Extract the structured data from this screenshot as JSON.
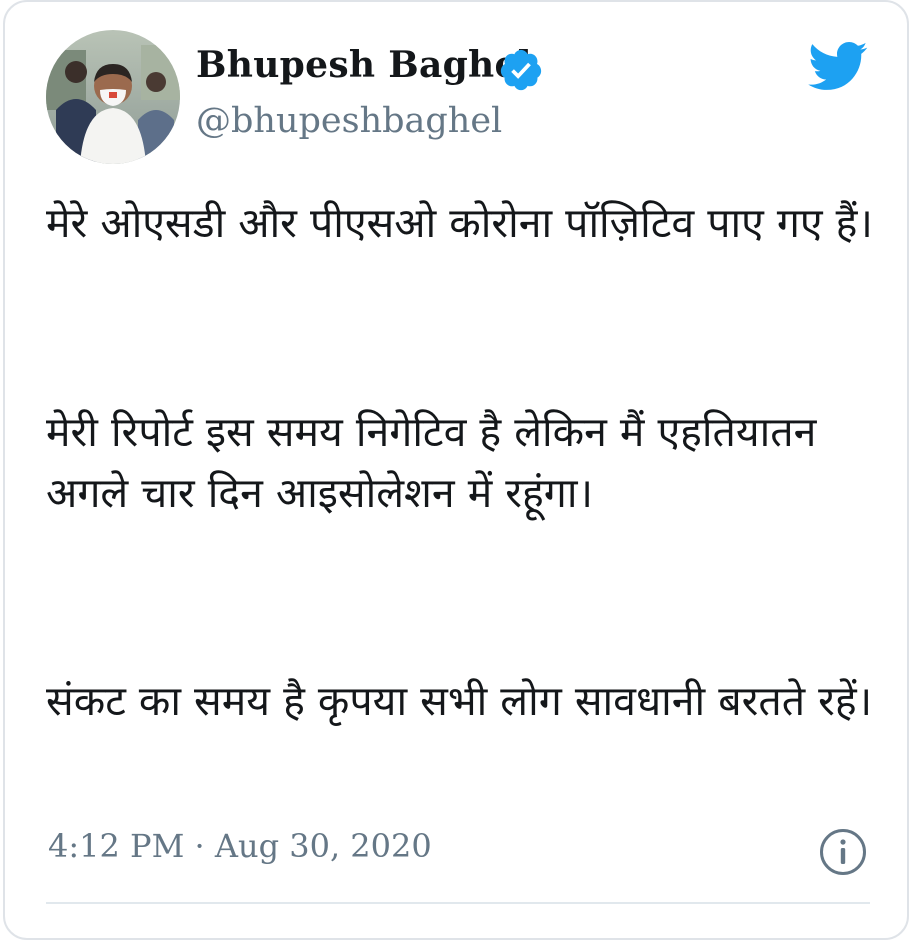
{
  "author": {
    "name": "Bhupesh Baghel",
    "handle": "@bhupeshbaghel"
  },
  "tweet": {
    "paragraphs": [
      "मेरे ओएसडी और पीएसओ कोरोना पॉज़िटिव पाए गए हैं।",
      "मेरी रिपोर्ट इस समय निगेटिव है लेकिन मैं एहतियातन अगले चार दिन आइसोलेशन में रहूंगा।",
      "संकट का समय है कृपया सभी लोग सावधानी बरतते रहें।"
    ],
    "timestamp": "4:12 PM · Aug 30, 2020"
  },
  "icons": {
    "verified": "verified-badge-icon",
    "brand": "twitter-bird-icon",
    "info": "info-icon"
  },
  "colors": {
    "text": "#14171a",
    "muted": "#657786",
    "brand": "#1da1f2",
    "border": "#dfe3e8"
  }
}
